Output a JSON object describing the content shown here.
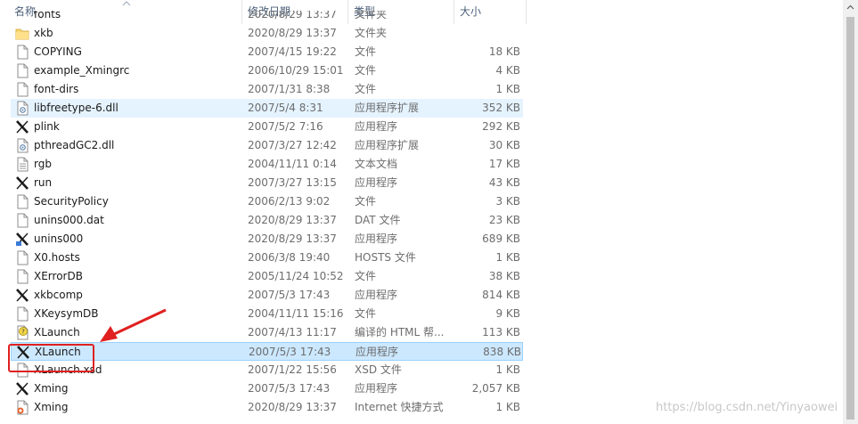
{
  "columns": {
    "name": "名称",
    "date": "修改日期",
    "type": "类型",
    "size": "大小"
  },
  "files": [
    {
      "name": "xkb",
      "date": "2020/8/29 13:37",
      "type": "文件夹",
      "size": "",
      "icon": "folder"
    },
    {
      "name": "COPYING",
      "date": "2007/4/15 19:22",
      "type": "文件",
      "size": "18 KB",
      "icon": "file"
    },
    {
      "name": "example_Xmingrc",
      "date": "2006/10/29 15:01",
      "type": "文件",
      "size": "4 KB",
      "icon": "file"
    },
    {
      "name": "font-dirs",
      "date": "2007/1/31 8:38",
      "type": "文件",
      "size": "1 KB",
      "icon": "file"
    },
    {
      "name": "libfreetype-6.dll",
      "date": "2007/5/4 8:31",
      "type": "应用程序扩展",
      "size": "352 KB",
      "icon": "dll"
    },
    {
      "name": "plink",
      "date": "2007/5/2 7:16",
      "type": "应用程序",
      "size": "292 KB",
      "icon": "x-app"
    },
    {
      "name": "pthreadGC2.dll",
      "date": "2007/3/27 12:42",
      "type": "应用程序扩展",
      "size": "30 KB",
      "icon": "dll"
    },
    {
      "name": "rgb",
      "date": "2004/11/11 0:14",
      "type": "文本文档",
      "size": "17 KB",
      "icon": "text"
    },
    {
      "name": "run",
      "date": "2007/3/27 13:15",
      "type": "应用程序",
      "size": "43 KB",
      "icon": "x-app"
    },
    {
      "name": "SecurityPolicy",
      "date": "2006/2/13 9:02",
      "type": "文件",
      "size": "3 KB",
      "icon": "file"
    },
    {
      "name": "unins000.dat",
      "date": "2020/8/29 13:37",
      "type": "DAT 文件",
      "size": "23 KB",
      "icon": "file"
    },
    {
      "name": "unins000",
      "date": "2020/8/29 13:37",
      "type": "应用程序",
      "size": "689 KB",
      "icon": "uninstall"
    },
    {
      "name": "X0.hosts",
      "date": "2006/3/8 19:40",
      "type": "HOSTS 文件",
      "size": "1 KB",
      "icon": "file"
    },
    {
      "name": "XErrorDB",
      "date": "2005/11/24 10:52",
      "type": "文件",
      "size": "38 KB",
      "icon": "file"
    },
    {
      "name": "xkbcomp",
      "date": "2007/5/3 17:43",
      "type": "应用程序",
      "size": "814 KB",
      "icon": "x-app"
    },
    {
      "name": "XKeysymDB",
      "date": "2004/11/11 15:16",
      "type": "文件",
      "size": "9 KB",
      "icon": "file"
    },
    {
      "name": "XLaunch",
      "date": "2007/4/13 11:17",
      "type": "编译的 HTML 帮...",
      "size": "113 KB",
      "icon": "help"
    },
    {
      "name": "XLaunch",
      "date": "2007/5/3 17:43",
      "type": "应用程序",
      "size": "838 KB",
      "icon": "x-app"
    },
    {
      "name": "XLaunch.xsd",
      "date": "2007/1/22 15:56",
      "type": "XSD 文件",
      "size": "1 KB",
      "icon": "file"
    },
    {
      "name": "Xming",
      "date": "2007/5/3 17:43",
      "type": "应用程序",
      "size": "2,057 KB",
      "icon": "x-app"
    },
    {
      "name": "Xming",
      "date": "2020/8/29 13:37",
      "type": "Internet 快捷方式",
      "size": "1 KB",
      "icon": "url"
    }
  ],
  "selected_index": 17,
  "hover_index": 4,
  "partial_row": {
    "name": "fonts",
    "date": "2020/8/29 13:37",
    "type": "文件夹"
  },
  "watermark": "https://blog.csdn.net/Yinyaowei",
  "colors": {
    "selected": "#cce8ff",
    "hover": "#e5f3ff",
    "highlight_box": "#e02020",
    "arrow": "#e02020"
  }
}
